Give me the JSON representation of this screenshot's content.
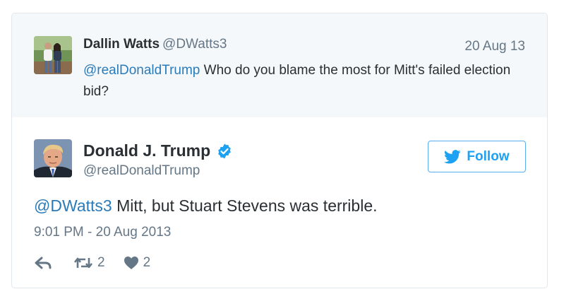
{
  "reply_tweet": {
    "name": "Dallin Watts",
    "handle": "@DWatts3",
    "date": "20 Aug 13",
    "mention": "@realDonaldTrump",
    "text": " Who do you blame the most for Mitt's failed election bid?"
  },
  "main_tweet": {
    "name": "Donald J. Trump",
    "handle": "@realDonaldTrump",
    "verified_icon": "verified-badge-icon",
    "follow_label": "Follow",
    "mention": "@DWatts3",
    "text": " Mitt, but Stuart Stevens was terrible.",
    "timestamp": "9:01 PM - 20 Aug 2013",
    "retweet_count": "2",
    "like_count": "2"
  },
  "colors": {
    "link": "#2b7bb9",
    "twitter_blue": "#1da1f2",
    "muted": "#657786",
    "reply_background": "#f5f8fa"
  }
}
